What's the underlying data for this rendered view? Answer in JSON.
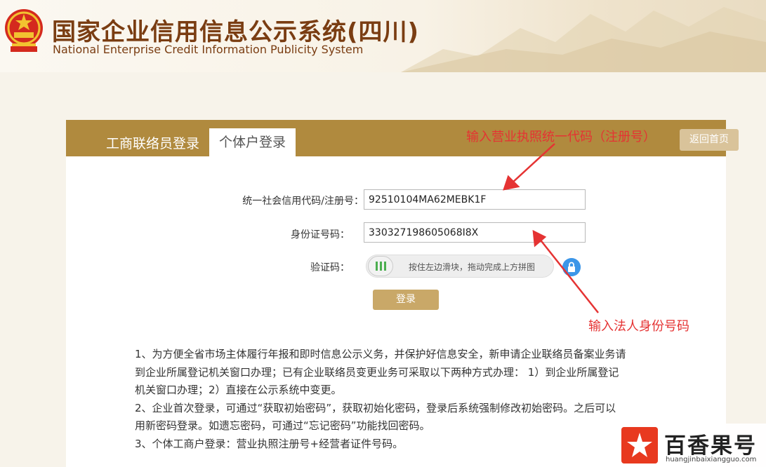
{
  "header": {
    "title_cn": "国家企业信用信息公示系统(四川)",
    "title_en": "National Enterprise Credit Information Publicity System"
  },
  "tabs": {
    "staff_login": "工商联络员登录",
    "individual_login": "个体户登录",
    "home_button": "返回首页"
  },
  "form": {
    "code_label": "统一社会信用代码/注册号：",
    "code_value": "92510104MA62MEBK1F",
    "id_label": "身份证号码：",
    "id_value": "330327198605068I8X",
    "captcha_label": "验证码：",
    "slider_hint": "按住左边滑块，拖动完成上方拼图",
    "login_button": "登录"
  },
  "annotations": {
    "top": "输入营业执照统一代码（注册号）",
    "bottom": "输入法人身份号码"
  },
  "notes": [
    "1、为方便全省市场主体履行年报和即时信息公示义务，并保护好信息安全，新申请企业联络员备案业务请",
    "到企业所属登记机关窗口办理；已有企业联络员变更业务可采取以下两种方式办理： 1）到企业所属登记",
    "机关窗口办理；2）直接在公示系统中变更。",
    "2、企业首次登录，可通过“获取初始密码”，获取初始化密码，登录后系统强制修改初始密码。之后可以",
    "用新密码登录。如遗忘密码，可通过“忘记密码”功能找回密码。",
    "3、个体工商户登录：营业执照注册号+经营者证件号码。"
  ],
  "watermark": {
    "name": "百香果号",
    "url": "huangjinbaixiangguo.com"
  },
  "colors": {
    "brand_brown": "#7a3d12",
    "tab_bar": "#b08a3e",
    "annotation_red": "#e53333",
    "login_button": "#c9a868"
  },
  "icons": [
    "national-emblem-icon",
    "slider-grip-icon",
    "lock-icon",
    "arrow-icon",
    "star-logo-icon"
  ]
}
